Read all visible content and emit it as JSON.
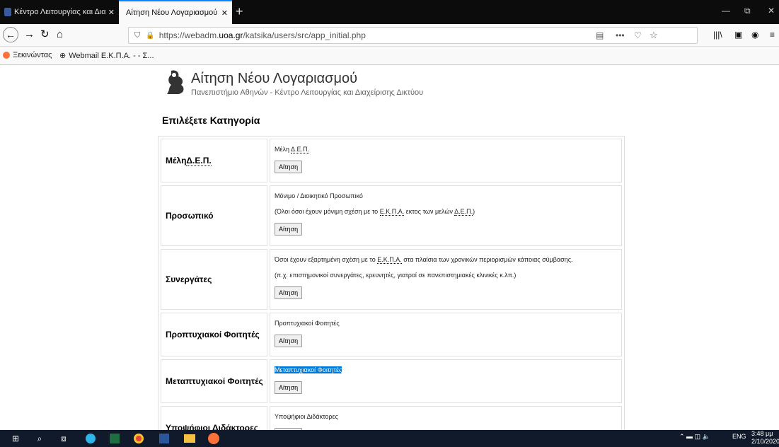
{
  "browser": {
    "tabs": [
      {
        "title": "Κέντρο Λειτουργίας και Διαχεί"
      },
      {
        "title": "Αίτηση Νέου Λογαριασμού — Κέν"
      }
    ],
    "url_prefix": "https://webadm.",
    "url_domain": "uoa.gr",
    "url_path": "/katsika/users/src/app_initial.php",
    "bookmarks": [
      "Ξεκινώντας",
      "Webmail Ε.Κ.Π.Α. - - Σ..."
    ]
  },
  "page": {
    "title": "Αίτηση Νέου Λογαριασμού",
    "subtitle": "Πανεπιστήμιο Αθηνών - Κέντρο Λειτουργίας και Διαχείρισης Δικτύου",
    "category_heading": "Επιλέξετε Κατηγορία",
    "apply_label": "Αίτηση",
    "rows": [
      {
        "label_pre": "Μέλη ",
        "label_abbr": "Δ.Ε.Π.",
        "lines": [
          {
            "pre": "Μέλη ",
            "abbr": "Δ.Ε.Π.",
            "post": ""
          }
        ]
      },
      {
        "label": "Προσωπικό",
        "lines": [
          {
            "pre": "Μόνιμο / Διοικητικό Προσωπικό",
            "abbr": "",
            "post": ""
          },
          {
            "pre": "(Όλοι όσοι έχουν μόνιμη σχέση με το ",
            "abbr": "Ε.Κ.Π.Α.",
            "post": " εκτος των μελών ",
            "abbr2": "Δ.Ε.Π.",
            "post2": ")"
          }
        ]
      },
      {
        "label": "Συνεργάτες",
        "lines": [
          {
            "pre": "Όσοι έχουν εξαρτημένη σχέση με το ",
            "abbr": "Ε.Κ.Π.Α.",
            "post": " στα πλαίσια των χρονικών περιορισμών κάποιας σύμβασης."
          },
          {
            "pre": "(π.χ. επιστημονικοί συνεργάτες, ερευνητές, γιατροί σε πανεπιστημιακές κλινικές κ.λπ.)",
            "abbr": "",
            "post": ""
          }
        ]
      },
      {
        "label": "Προπτυχιακοί Φοιτητές",
        "lines": [
          {
            "pre": "Προπτυχιακοί Φοιτητές",
            "abbr": "",
            "post": ""
          }
        ]
      },
      {
        "label": "Μεταπτυχιακοί Φοιτητές",
        "lines": [
          {
            "pre": "Μεταπτυχιακοί Φοιτητές",
            "abbr": "",
            "post": ""
          }
        ]
      },
      {
        "label": "Υποψήφιοι Διδάκτορες",
        "lines": [
          {
            "pre": "Υποψήφιοι Διδάκτορες",
            "abbr": "",
            "post": ""
          }
        ]
      }
    ]
  },
  "taskbar": {
    "lang": "ENG",
    "time": "3:48 μμ",
    "date": "2/10/2020"
  }
}
